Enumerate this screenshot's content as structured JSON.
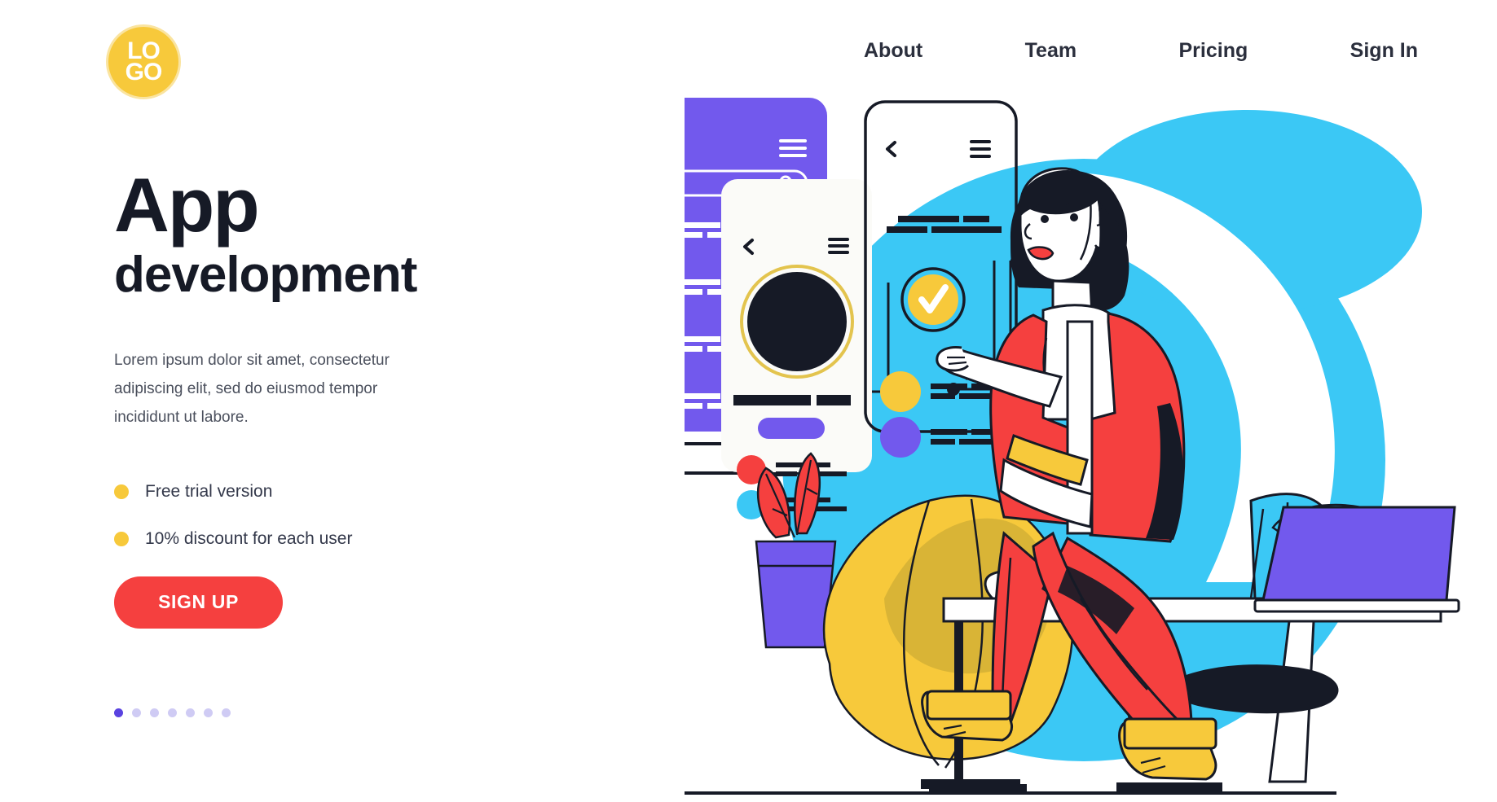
{
  "brand": {
    "logo_line1": "LO",
    "logo_line2": "GO",
    "logo_color": "#F7C93B"
  },
  "nav": {
    "items": [
      {
        "label": "About"
      },
      {
        "label": "Team"
      },
      {
        "label": "Pricing"
      },
      {
        "label": "Sign In"
      }
    ]
  },
  "hero": {
    "title_line1": "App",
    "title_line2": "development",
    "paragraph": "Lorem ipsum dolor sit amet, consectetur adipiscing elit, sed do eiusmod tempor incididunt ut labore.",
    "bullets": [
      {
        "label": "Free trial version"
      },
      {
        "label": "10% discount for each user"
      }
    ],
    "cta_label": "SIGN UP"
  },
  "pagination": {
    "total": 7,
    "active_index": 0,
    "active_color": "#5A43E0",
    "inactive_color": "#CFCBF4"
  },
  "colors": {
    "accent_red": "#F5403F",
    "accent_yellow": "#F7C93B",
    "accent_purple": "#7259ED",
    "accent_cyan": "#3BC8F5",
    "ink": "#161A26",
    "body_text": "#4A4F5C"
  },
  "illustration": {
    "alt": "Woman at desk with laptop pointing at app screens",
    "scene_elements": [
      "purple-phone-panel",
      "white-phone-panel",
      "outlined-phone-panel",
      "woman-character",
      "laptop",
      "desk",
      "beanbag-chair",
      "potted-plant",
      "blue-blob-background"
    ]
  }
}
